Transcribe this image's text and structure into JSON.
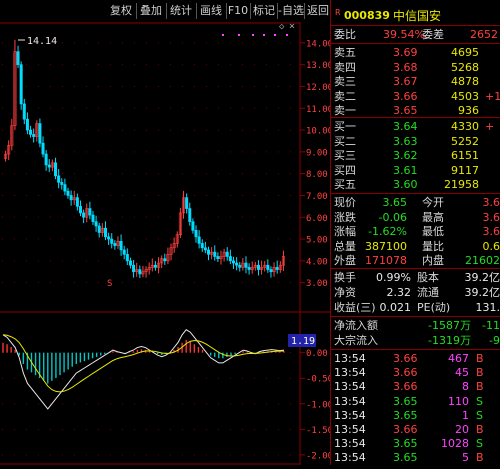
{
  "toolbar": {
    "items": [
      "复权",
      "叠加",
      "统计",
      "画线",
      "F10",
      "标记",
      "-自选",
      "返回"
    ],
    "close_glyph": "×"
  },
  "colors": {
    "up": "#ff4040",
    "down": "#22dd22",
    "volume_line": "#e8e800",
    "label": "#d8d8d8",
    "border": "#8a0000",
    "macd_pos": "#ff3333",
    "macd_neg": "#00c8c8"
  },
  "chart": {
    "max_label": "14.14",
    "price_ticks": [
      "14.00",
      "13.00",
      "12.00",
      "11.00",
      "10.00",
      "9.00",
      "8.00",
      "7.00",
      "6.00",
      "5.00",
      "4.00",
      "3.00"
    ],
    "marker_s": "S",
    "indicator_ticks": [
      "0.00",
      "-0.50",
      "-1.00",
      "-1.50",
      "-2.00"
    ],
    "indicator_tag": "1.19",
    "scroll_glyph": "◇"
  },
  "chart_data": {
    "type": "candlestick",
    "price_range": [
      2.8,
      14.5
    ],
    "indicator_range": [
      -2.1,
      0.6
    ],
    "closes": [
      8.9,
      9.3,
      10.2,
      13.6,
      13.0,
      11.2,
      10.5,
      10.0,
      9.8,
      9.7,
      10.3,
      9.4,
      8.9,
      8.4,
      8.3,
      8.5,
      7.9,
      7.6,
      7.5,
      7.2,
      7.0,
      6.8,
      6.9,
      6.5,
      6.2,
      6.0,
      6.4,
      6.1,
      5.8,
      5.6,
      5.3,
      5.5,
      5.1,
      5.0,
      4.8,
      4.7,
      4.9,
      4.5,
      4.3,
      4.0,
      3.8,
      3.5,
      3.6,
      3.4,
      3.5,
      3.6,
      3.7,
      3.8,
      3.7,
      3.9,
      4.1,
      4.0,
      4.3,
      4.6,
      4.8,
      5.2,
      6.2,
      6.9,
      6.4,
      5.8,
      5.4,
      5.1,
      4.8,
      4.6,
      4.5,
      4.3,
      4.4,
      4.2,
      4.1,
      4.2,
      4.4,
      4.2,
      4.0,
      3.9,
      3.8,
      3.7,
      3.9,
      3.7,
      3.6,
      3.7,
      3.8,
      3.6,
      3.7,
      3.8,
      3.6,
      3.5,
      3.7,
      3.6,
      3.8,
      4.2
    ],
    "macd": [
      0.35,
      0.3,
      0.2,
      0.1,
      -0.1,
      -0.4,
      -0.6,
      -0.7,
      -0.8,
      -0.9,
      -1.0,
      -1.1,
      -1.0,
      -0.9,
      -0.8,
      -0.7,
      -0.6,
      -0.5,
      -0.4,
      -0.35,
      -0.3,
      -0.25,
      -0.2,
      -0.15,
      -0.1,
      -0.05,
      0.0,
      0.05,
      0.02,
      0.0,
      -0.02,
      0.02,
      0.05,
      0.1,
      0.12,
      0.1,
      0.05,
      0.0,
      -0.05,
      -0.08,
      -0.05,
      0.0,
      0.1,
      0.2,
      0.35,
      0.45,
      0.4,
      0.3,
      0.2,
      0.1,
      0.0,
      -0.1,
      -0.15,
      -0.2,
      -0.2,
      -0.15,
      -0.1,
      -0.05,
      0.0,
      0.05,
      0.03,
      0.0,
      -0.02,
      0.02,
      0.04,
      0.05,
      0.06,
      0.05,
      0.04,
      0.05
    ]
  },
  "quote": {
    "flag": "R",
    "code": "000839",
    "name": "中信国安",
    "weibi_label": "委比",
    "weibi_value": "39.54%",
    "weicha_label": "委差",
    "weicha_value": "2652",
    "asks": [
      {
        "label": "卖五",
        "price": "3.69",
        "volume": "4695",
        "extra": ""
      },
      {
        "label": "卖四",
        "price": "3.68",
        "volume": "5268",
        "extra": ""
      },
      {
        "label": "卖三",
        "price": "3.67",
        "volume": "4878",
        "extra": ""
      },
      {
        "label": "卖二",
        "price": "3.66",
        "volume": "4503",
        "extra": "+1"
      },
      {
        "label": "卖一",
        "price": "3.65",
        "volume": "936",
        "extra": ""
      }
    ],
    "bids": [
      {
        "label": "买一",
        "price": "3.64",
        "volume": "4330",
        "extra": "+"
      },
      {
        "label": "买二",
        "price": "3.63",
        "volume": "5252",
        "extra": ""
      },
      {
        "label": "买三",
        "price": "3.62",
        "volume": "6151",
        "extra": ""
      },
      {
        "label": "买四",
        "price": "3.61",
        "volume": "9117",
        "extra": ""
      },
      {
        "label": "买五",
        "price": "3.60",
        "volume": "21958",
        "extra": ""
      }
    ],
    "stats": [
      {
        "l1": "现价",
        "v1": "3.65",
        "l2": "今开",
        "v2": "3.6"
      },
      {
        "l1": "涨跌",
        "v1": "-0.06",
        "l2": "最高",
        "v2": "3.6"
      },
      {
        "l1": "涨幅",
        "v1": "-1.62%",
        "l2": "最低",
        "v2": "3.6"
      },
      {
        "l1": "总量",
        "v1": "387100",
        "l2": "量比",
        "v2": "0.6"
      },
      {
        "l1": "外盘",
        "v1": "171078",
        "l2": "内盘",
        "v2": "21602"
      }
    ],
    "stats2": [
      {
        "l1": "换手",
        "v1": "0.99%",
        "l2": "股本",
        "v2": "39.2亿"
      },
      {
        "l1": "净资",
        "v1": "2.32",
        "l2": "流通",
        "v2": "39.2亿"
      },
      {
        "l1": "收益(三)",
        "v1": "0.021",
        "l2": "PE(动)",
        "v2": "131."
      }
    ],
    "flows": [
      {
        "label": "净流入额",
        "v1": "-1587万",
        "v2": "-11"
      },
      {
        "label": "大宗流入",
        "v1": "-1319万",
        "v2": "-9"
      }
    ],
    "ticks": [
      {
        "time": "13:54",
        "price": "3.66",
        "vol": "467",
        "dir": "B"
      },
      {
        "time": "13:54",
        "price": "3.66",
        "vol": "45",
        "dir": "B"
      },
      {
        "time": "13:54",
        "price": "3.66",
        "vol": "8",
        "dir": "B"
      },
      {
        "time": "13:54",
        "price": "3.65",
        "vol": "110",
        "dir": "S"
      },
      {
        "time": "13:54",
        "price": "3.65",
        "vol": "1",
        "dir": "S"
      },
      {
        "time": "13:54",
        "price": "3.66",
        "vol": "20",
        "dir": "B"
      },
      {
        "time": "13:54",
        "price": "3.65",
        "vol": "1028",
        "dir": "S"
      },
      {
        "time": "13:54",
        "price": "3.65",
        "vol": "5",
        "dir": "B"
      }
    ]
  }
}
